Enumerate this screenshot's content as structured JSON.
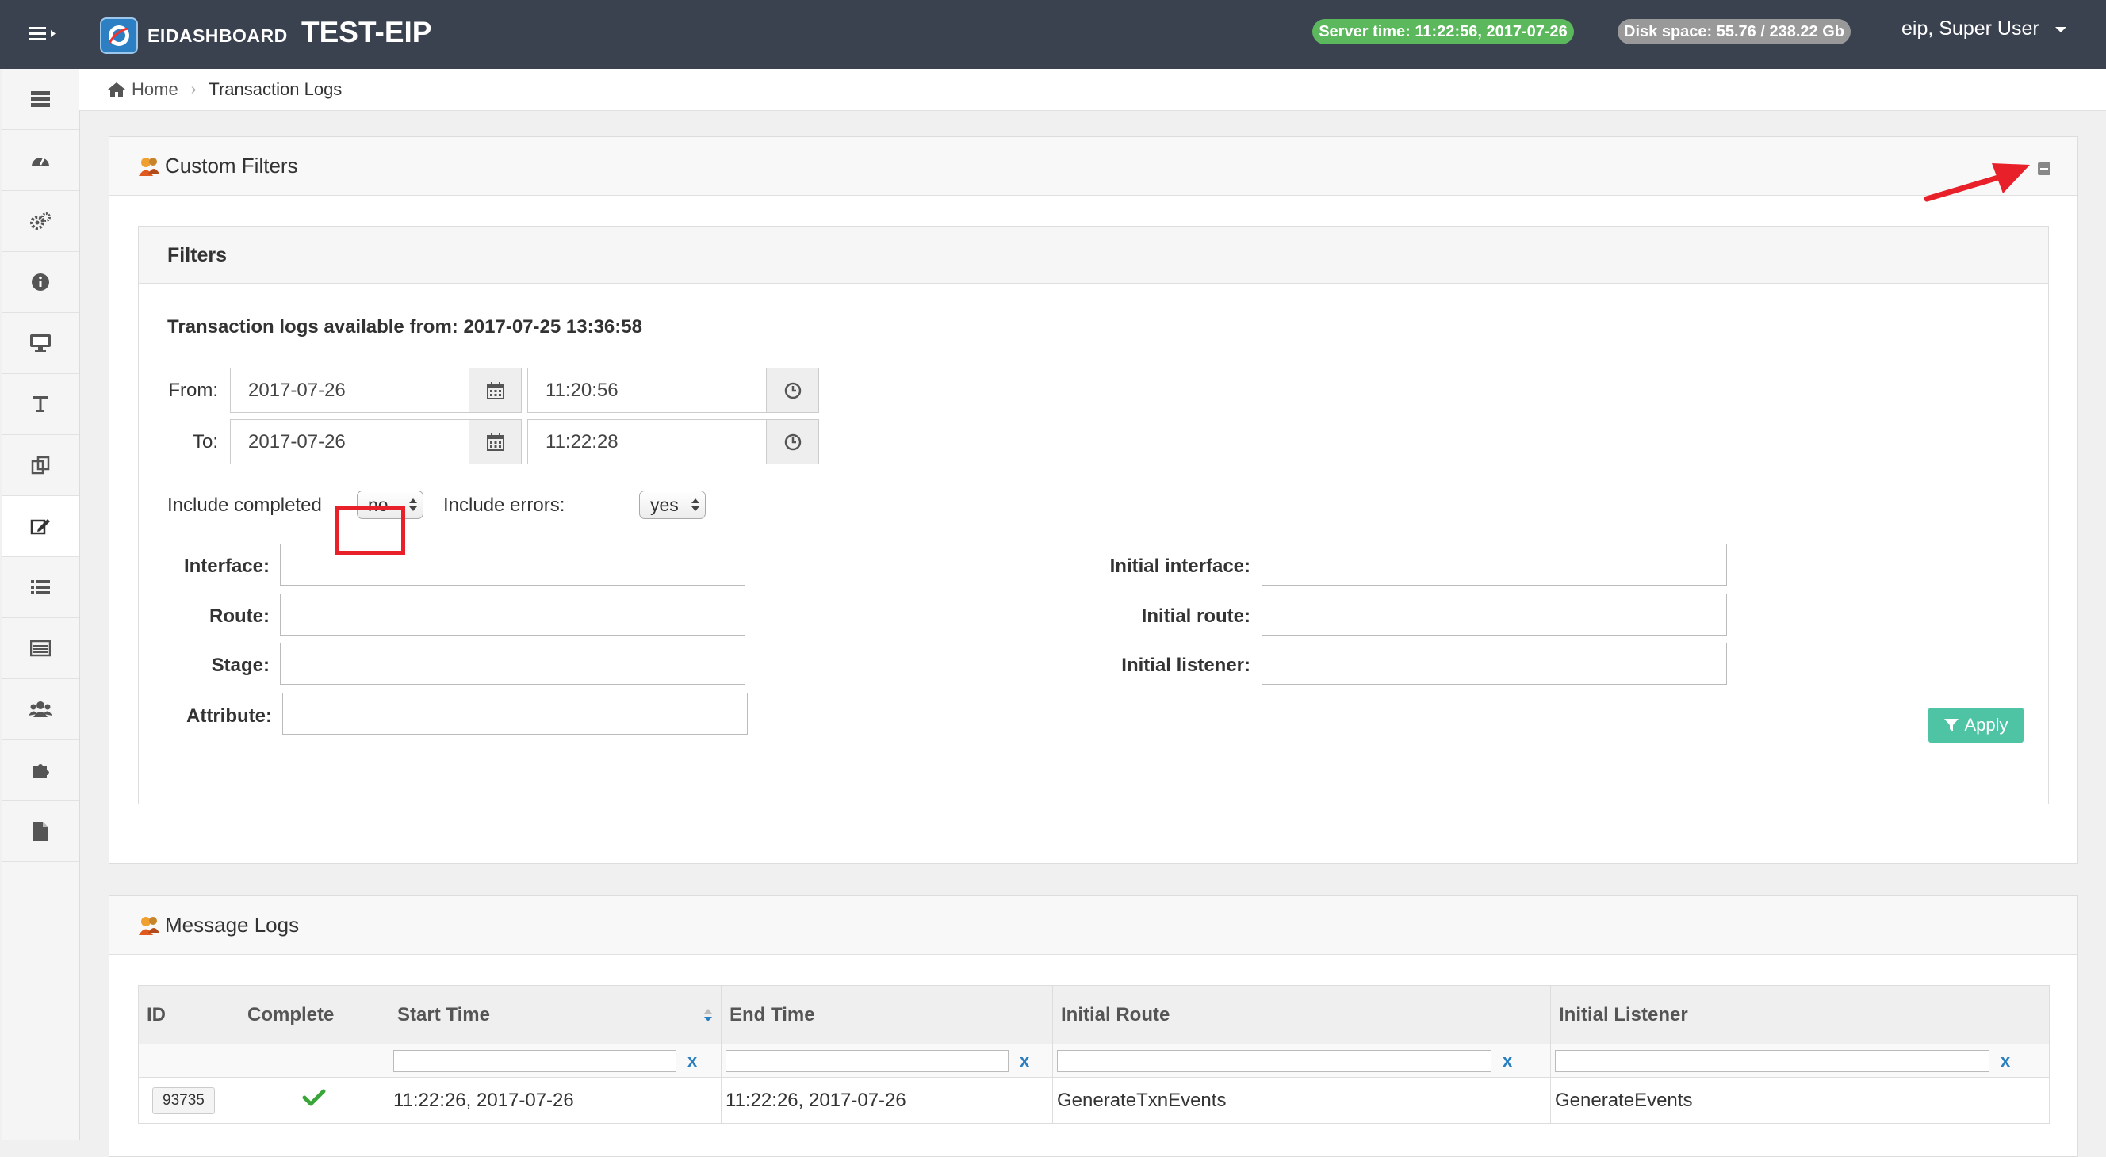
{
  "app": {
    "brand": "EIDASHBOARD",
    "environment": "TEST-EIP",
    "server_time": "Server time: 11:22:56, 2017-07-26",
    "disk_space": "Disk space: 55.76 / 238.22 Gb",
    "user": "eip, Super User"
  },
  "sidebar": {
    "items": [
      {
        "icon": "server-icon"
      },
      {
        "icon": "dashboard-icon"
      },
      {
        "icon": "gears-icon"
      },
      {
        "icon": "info-icon"
      },
      {
        "icon": "desktop-icon"
      },
      {
        "icon": "text-icon"
      },
      {
        "icon": "copy-icon"
      },
      {
        "icon": "edit-icon",
        "active": true
      },
      {
        "icon": "list-icon"
      },
      {
        "icon": "table-list-icon"
      },
      {
        "icon": "users-icon"
      },
      {
        "icon": "puzzle-icon"
      },
      {
        "icon": "file-icon"
      }
    ]
  },
  "breadcrumb": {
    "home": "Home",
    "current": "Transaction Logs"
  },
  "custom_filters": {
    "title": "Custom Filters",
    "filters_title": "Filters",
    "available_from": "Transaction logs available from: 2017-07-25 13:36:58",
    "from_label": "From:",
    "from_date": "2017-07-26",
    "from_time": "11:20:56",
    "to_label": "To:",
    "to_date": "2017-07-26",
    "to_time": "11:22:28",
    "include_completed_label": "Include completed",
    "include_completed_value": "no",
    "include_errors_label": "Include errors:",
    "include_errors_value": "yes",
    "interface_label": "Interface:",
    "route_label": "Route:",
    "stage_label": "Stage:",
    "attribute_label": "Attribute:",
    "initial_interface_label": "Initial interface:",
    "initial_route_label": "Initial route:",
    "initial_listener_label": "Initial listener:",
    "apply_label": "Apply"
  },
  "message_logs": {
    "title": "Message Logs",
    "columns": [
      "ID",
      "Complete",
      "Start Time",
      "End Time",
      "Initial Route",
      "Initial Listener"
    ],
    "clear_symbol": "x",
    "rows": [
      {
        "id": "93735",
        "complete": true,
        "start_time": "11:22:26, 2017-07-26",
        "end_time": "11:22:26, 2017-07-26",
        "initial_route": "GenerateTxnEvents",
        "initial_listener": "GenerateEvents"
      }
    ]
  },
  "colors": {
    "navbar": "#3a4250",
    "server_time_pill": "#5cb85c",
    "disk_space_pill": "#999999",
    "apply_button": "#4fc4a4",
    "highlight": "#e8202a",
    "link_blue": "#2a7fc0"
  }
}
